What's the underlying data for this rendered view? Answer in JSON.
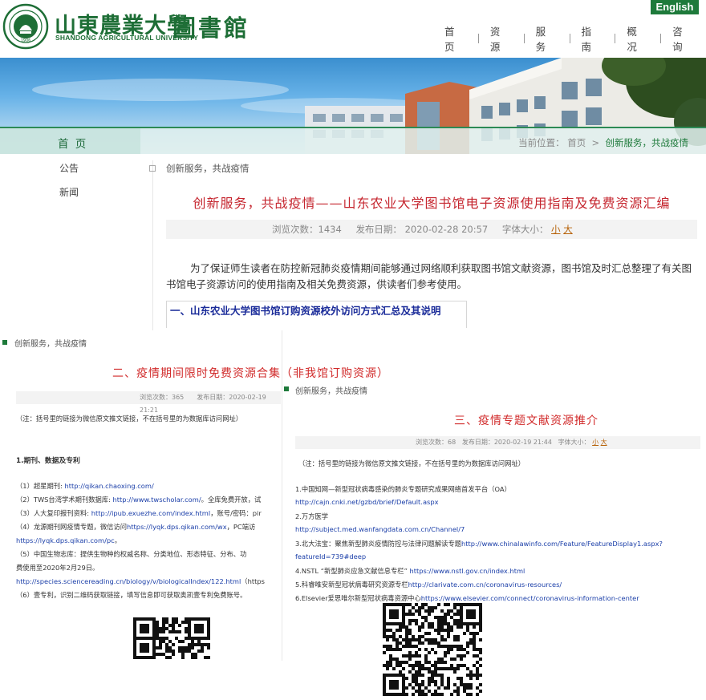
{
  "header": {
    "logo_cn": "山東農業大學",
    "logo_en": "SHANDONG AGRICULTURAL UNIVERSITY",
    "library_cn": "圖書館",
    "lang_button": "English",
    "nav": [
      "首页",
      "资源",
      "服务",
      "指南",
      "概况",
      "咨询"
    ],
    "colors": {
      "brand_green": "#1e7a3b",
      "title_red": "#c5252e",
      "link_blue": "#1a3ea8"
    }
  },
  "subbar": {
    "home_tab": "首 页",
    "breadcrumb_prefix": "当前位置：",
    "breadcrumb_home": "首页",
    "breadcrumb_sep": ">",
    "breadcrumb_current": "创新服务，共战疫情"
  },
  "sidebar": {
    "items": [
      "公告",
      "新闻"
    ]
  },
  "article1": {
    "category": "创新服务，共战疫情",
    "title": "创新服务，共战疫情——山东农业大学图书馆电子资源使用指南及免费资源汇编",
    "views_label": "浏览次数：1434",
    "date_label": "发布日期：",
    "date": "2020-02-28 20:57",
    "fontsize_label": "字体大小：",
    "size_small": "小",
    "size_large": "大",
    "paragraph": "为了保证师生读者在防控新冠肺炎疫情期间能够通过网络顺利获取图书馆文献资源，图书馆及时汇总整理了有关图书馆电子资源访问的使用指南及相关免费资源，供读者们参考使用。",
    "section_heading": "一、山东农业大学图书馆订购资源校外访问方式汇总及其说明"
  },
  "article2": {
    "category": "创新服务，共战疫情",
    "title": "二、疫情期间限时免费资源合集（非我馆订购资源）",
    "meta": "浏览次数：365　　发布日期：2020-02-19 21:21",
    "note": "（注：括号里的链接为微信原文推文链接，不在括号里的为数据库访问网址）",
    "section": "1.期刊、数据及专利",
    "lines": [
      {
        "pre": "（1）超星期刊: ",
        "link": "http://qikan.chaoxing.com/",
        "post": ""
      },
      {
        "pre": "（2）TWS台湾学术期刊数据库: ",
        "link": "http://www.twscholar.com/",
        "post": "。全库免费开放，试"
      },
      {
        "pre": "（3）人大复印报刊资料: ",
        "link": "http://ipub.exuezhe.com/index.html",
        "post": "，账号/密码：pir"
      },
      {
        "pre": "（4）龙源期刊网疫情专题，微信访问",
        "link": "https://lyqk.dps.qikan.com/wx",
        "post": "，PC端访"
      },
      {
        "pre": "",
        "link": "https://lyqk.dps.qikan.com/pc",
        "post": "。"
      },
      {
        "pre": "（5）中国生物志库：提供生物种的权威名称、分类地位、形态特征、分布、功",
        "link": "",
        "post": ""
      },
      {
        "pre": "费使用至2020年2月29日。",
        "link": "",
        "post": ""
      },
      {
        "pre": "",
        "link": "http://species.sciencereading.cn/biology/v/biologicalIndex/122.html",
        "post": "（https"
      },
      {
        "pre": "（6）壹专利，识别二维码获取链接，填写信息即可获取奥凯壹专利免费账号。",
        "link": "",
        "post": ""
      }
    ]
  },
  "article3": {
    "category": "创新服务，共战疫情",
    "title": "三、疫情专题文献资源推介",
    "meta_views": "浏览次数：68",
    "meta_date": "发布日期：2020-02-19 21:44",
    "meta_size": "字体大小：",
    "size_small": "小",
    "size_large": "大",
    "note": "（注：括号里的链接为微信原文推文链接，不在括号里的为数据库访问网址）",
    "lines": [
      {
        "pre": "1.中国知网—新型冠状病毒感染的肺炎专题研究成果网络首发平台（OA）",
        "link": "",
        "post": ""
      },
      {
        "pre": "",
        "link": "http://cajn.cnki.net/gzbd/brief/Default.aspx",
        "post": ""
      },
      {
        "pre": "2.万方医学",
        "link": "",
        "post": ""
      },
      {
        "pre": "",
        "link": "http://subject.med.wanfangdata.com.cn/Channel/7",
        "post": ""
      },
      {
        "pre": "3.北大法宝：聚焦新型肺炎疫情防控与法律问题解读专题",
        "link": "http://www.chinalawinfo.com/Feature/FeatureDisplay1.aspx?",
        "post": ""
      },
      {
        "pre": "",
        "link": "featureId=739#deep",
        "post": ""
      },
      {
        "pre": "4.NSTL “新型肺炎应急文献信息专栏”  ",
        "link": "https://www.nstl.gov.cn/index.html",
        "post": ""
      },
      {
        "pre": "5.科睿唯安新型冠状病毒研究资源专栏",
        "link": "http://clarivate.com.cn/coronavirus-resources/",
        "post": ""
      },
      {
        "pre": "6.Elsevier爱思唯尔新型冠状病毒资源中心",
        "link": "https://www.elsevier.com/connect/coronavirus-information-center",
        "post": ""
      }
    ]
  }
}
